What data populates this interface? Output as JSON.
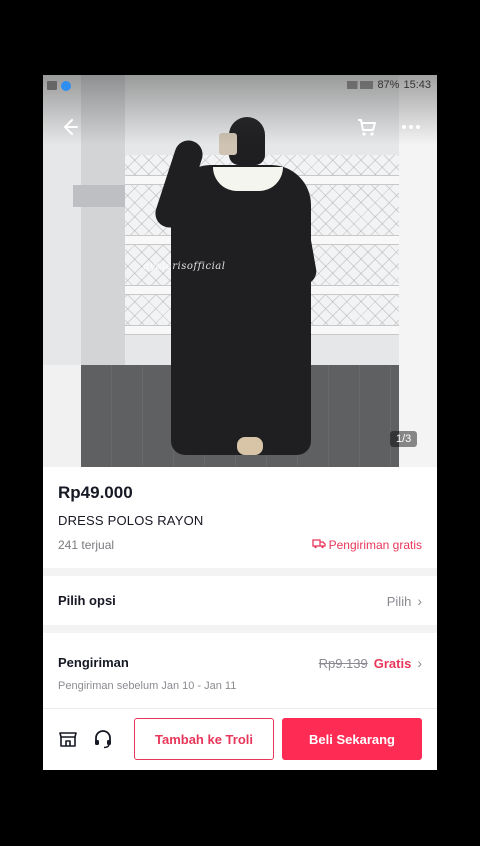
{
  "status_bar": {
    "time": "15:43",
    "battery": "87%"
  },
  "header": {
    "back_icon": "back-arrow-icon",
    "cart_icon": "cart-icon",
    "more_icon": "more-icon"
  },
  "product": {
    "image_watermark": "ayalarisofficial",
    "image_counter": "1/3",
    "price": "Rp49.000",
    "title": "DRESS POLOS RAYON",
    "sold": "241 terjual",
    "free_shipping": "Pengiriman gratis"
  },
  "options": {
    "label": "Pilih opsi",
    "action": "Pilih"
  },
  "shipping": {
    "label": "Pengiriman",
    "old_price": "Rp9.139",
    "free": "Gratis",
    "estimate": "Pengiriman sebelum Jan 10 - Jan 11"
  },
  "bottom_bar": {
    "shop_icon": "shop-icon",
    "support_icon": "headset-icon",
    "add_to_cart": "Tambah ke Troli",
    "buy_now": "Beli Sekarang"
  },
  "colors": {
    "accent": "#fe2c55",
    "text": "#161823",
    "muted": "#8a8b91"
  }
}
